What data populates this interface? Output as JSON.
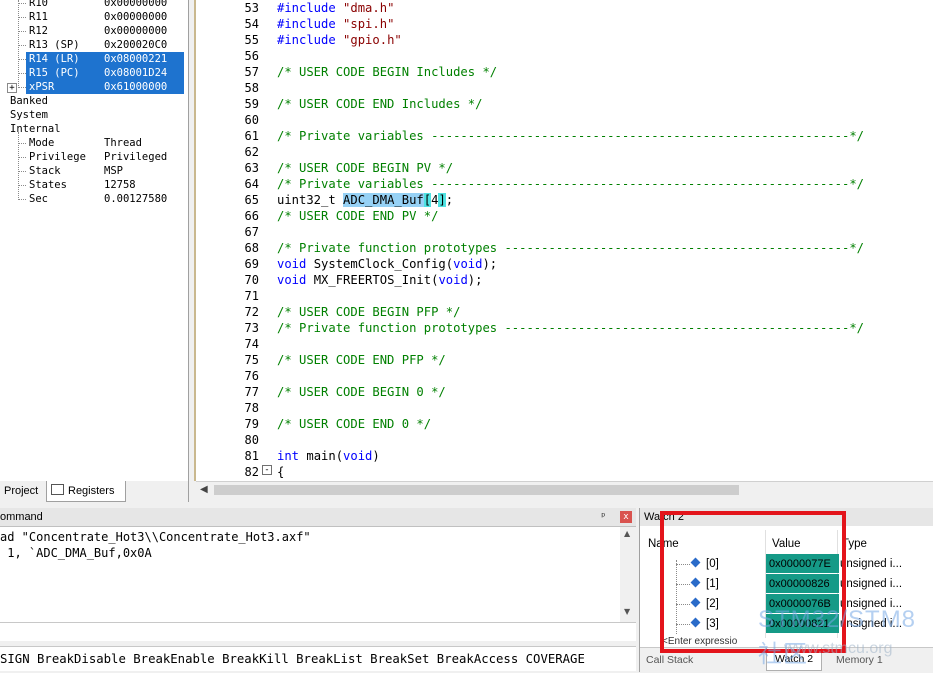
{
  "registers": {
    "rows": [
      {
        "name": "R10",
        "value": "0x00000000"
      },
      {
        "name": "R11",
        "value": "0x00000000"
      },
      {
        "name": "R12",
        "value": "0x00000000"
      },
      {
        "name": "R13 (SP)",
        "value": "0x200020C0"
      },
      {
        "name": "R14 (LR)",
        "value": "0x08000221"
      },
      {
        "name": "R15 (PC)",
        "value": "0x08001D24"
      },
      {
        "name": "xPSR",
        "value": "0x61000000"
      }
    ],
    "groups": [
      "Banked",
      "System",
      "Internal"
    ],
    "internal": [
      {
        "name": "Mode",
        "value": "Thread"
      },
      {
        "name": "Privilege",
        "value": "Privileged"
      },
      {
        "name": "Stack",
        "value": "MSP"
      },
      {
        "name": "States",
        "value": "12758"
      },
      {
        "name": "Sec",
        "value": "0.00127580"
      }
    ]
  },
  "left_tabs": {
    "project": "Project",
    "registers": "Registers"
  },
  "editor": {
    "lines": [
      {
        "n": "53",
        "parts": [
          {
            "t": "pp",
            "v": "#include "
          },
          {
            "t": "str",
            "v": "\"dma.h\""
          }
        ]
      },
      {
        "n": "54",
        "parts": [
          {
            "t": "pp",
            "v": "#include "
          },
          {
            "t": "str",
            "v": "\"spi.h\""
          }
        ]
      },
      {
        "n": "55",
        "parts": [
          {
            "t": "pp",
            "v": "#include "
          },
          {
            "t": "str",
            "v": "\"gpio.h\""
          }
        ]
      },
      {
        "n": "56",
        "parts": []
      },
      {
        "n": "57",
        "parts": [
          {
            "t": "cm",
            "v": "/* USER CODE BEGIN Includes */"
          }
        ]
      },
      {
        "n": "58",
        "parts": []
      },
      {
        "n": "59",
        "parts": [
          {
            "t": "cm",
            "v": "/* USER CODE END Includes */"
          }
        ]
      },
      {
        "n": "60",
        "parts": []
      },
      {
        "n": "61",
        "parts": [
          {
            "t": "cm",
            "v": "/* Private variables ---------------------------------------------------------*/"
          }
        ]
      },
      {
        "n": "62",
        "parts": []
      },
      {
        "n": "63",
        "parts": [
          {
            "t": "cm",
            "v": "/* USER CODE BEGIN PV */"
          }
        ]
      },
      {
        "n": "64",
        "parts": [
          {
            "t": "cm",
            "v": "/* Private variables ---------------------------------------------------------*/"
          }
        ]
      },
      {
        "n": "65",
        "parts": [
          {
            "t": "",
            "v": "uint32_t "
          },
          {
            "t": "hl",
            "v": "ADC_DMA_Buf"
          },
          {
            "t": "hl2",
            "v": "["
          },
          {
            "t": "",
            "v": "4"
          },
          {
            "t": "hl2",
            "v": "]"
          },
          {
            "t": "",
            "v": ";"
          }
        ]
      },
      {
        "n": "66",
        "parts": [
          {
            "t": "cm",
            "v": "/* USER CODE END PV */"
          }
        ]
      },
      {
        "n": "67",
        "parts": []
      },
      {
        "n": "68",
        "parts": [
          {
            "t": "cm",
            "v": "/* Private function prototypes -----------------------------------------------*/"
          }
        ]
      },
      {
        "n": "69",
        "parts": [
          {
            "t": "kw",
            "v": "void"
          },
          {
            "t": "",
            "v": " SystemClock_Config("
          },
          {
            "t": "kw",
            "v": "void"
          },
          {
            "t": "",
            "v": ");"
          }
        ]
      },
      {
        "n": "70",
        "parts": [
          {
            "t": "kw",
            "v": "void"
          },
          {
            "t": "",
            "v": " MX_FREERTOS_Init("
          },
          {
            "t": "kw",
            "v": "void"
          },
          {
            "t": "",
            "v": ");"
          }
        ]
      },
      {
        "n": "71",
        "parts": []
      },
      {
        "n": "72",
        "parts": [
          {
            "t": "cm",
            "v": "/* USER CODE BEGIN PFP */"
          }
        ]
      },
      {
        "n": "73",
        "parts": [
          {
            "t": "cm",
            "v": "/* Private function prototypes -----------------------------------------------*/"
          }
        ]
      },
      {
        "n": "74",
        "parts": []
      },
      {
        "n": "75",
        "parts": [
          {
            "t": "cm",
            "v": "/* USER CODE END PFP */"
          }
        ]
      },
      {
        "n": "76",
        "parts": []
      },
      {
        "n": "77",
        "parts": [
          {
            "t": "cm",
            "v": "/* USER CODE BEGIN 0 */"
          }
        ]
      },
      {
        "n": "78",
        "parts": []
      },
      {
        "n": "79",
        "parts": [
          {
            "t": "cm",
            "v": "/* USER CODE END 0 */"
          }
        ]
      },
      {
        "n": "80",
        "parts": []
      },
      {
        "n": "81",
        "parts": [
          {
            "t": "kw",
            "v": "int"
          },
          {
            "t": "",
            "v": " main("
          },
          {
            "t": "kw",
            "v": "void"
          },
          {
            "t": "",
            "v": ")"
          }
        ]
      },
      {
        "n": "82",
        "parts": [
          {
            "t": "",
            "v": "{"
          }
        ]
      }
    ],
    "fold_marker": "-"
  },
  "command": {
    "title": "ommand",
    "pin": "ᵖ",
    "close": "x",
    "lines": [
      "ad \"Concentrate_Hot3\\\\Concentrate_Hot3.axf\"",
      " 1, `ADC_DMA_Buf,0x0A"
    ],
    "statusbar": "SIGN BreakDisable BreakEnable BreakKill BreakList BreakSet BreakAccess COVERAGE"
  },
  "watch": {
    "title": "Watch 2",
    "columns": {
      "name": "Name",
      "value": "Value",
      "type": "Type"
    },
    "rows": [
      {
        "index": "[0]",
        "value": "0x0000077E",
        "type": "unsigned i..."
      },
      {
        "index": "[1]",
        "value": "0x00000826",
        "type": "unsigned i..."
      },
      {
        "index": "[2]",
        "value": "0x0000076B",
        "type": "unsigned i..."
      },
      {
        "index": "[3]",
        "value": "0x00000821",
        "type": "unsigned i..."
      }
    ],
    "enter_expression": "<Enter expressio",
    "tabs": {
      "call_stack": "Call Stack",
      "watch2": "Watch 2",
      "memory1": "Memory 1"
    }
  },
  "watermark": {
    "main": "STM32/STM8社区",
    "sub": "www.stmcu.org"
  },
  "colors": {
    "selection": "#1e73cf",
    "watch_value_bg": "#159a87",
    "highlight_box": "#e3141b"
  }
}
